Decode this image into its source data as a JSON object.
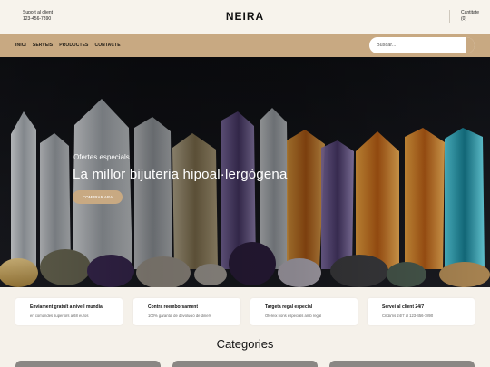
{
  "header": {
    "support_line1": "Suport al client",
    "support_line2": "123-456-7890",
    "logo": "NEIRA",
    "cart_label": "Cantitate",
    "cart_count": "(0)"
  },
  "nav": {
    "items": [
      "INICI",
      "SERVEIS",
      "PRODUCTES",
      "CONTACTE"
    ],
    "search_placeholder": "Buscar..."
  },
  "hero": {
    "subtitle": "Ofertes especials",
    "title": "La millor bijuteria hipoal·lergògena",
    "button": "COMPRAR ARA"
  },
  "features": [
    {
      "title": "Enviament gratuït a nivell mundial",
      "desc": "en comandes superiors a 68 euros"
    },
    {
      "title": "Contra reemborsament",
      "desc": "100% garantia de devolució de diners"
    },
    {
      "title": "Targeta regal especial",
      "desc": "Ofereix bons especials amb regal"
    },
    {
      "title": "Servei al client 24/7",
      "desc": "Crida'ns 24/7 al 123-456-7890"
    }
  ],
  "categories": {
    "title": "Categories"
  },
  "colors": {
    "accent": "#c8a982",
    "background": "#f5f1ea"
  }
}
